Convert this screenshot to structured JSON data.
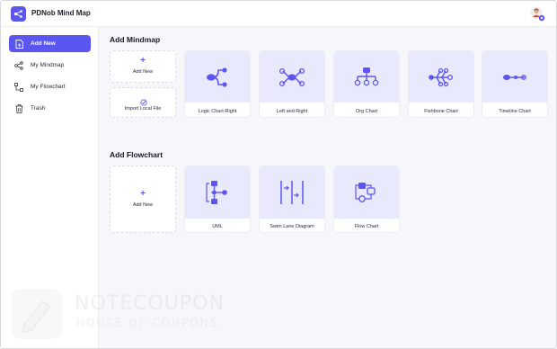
{
  "app": {
    "title": "PDNob Mind Map"
  },
  "sidebar": {
    "items": [
      {
        "label": "Add New",
        "icon": "file-plus-icon",
        "active": true
      },
      {
        "label": "My Mindmap",
        "icon": "share-nodes-icon",
        "active": false
      },
      {
        "label": "My Flowchart",
        "icon": "flowchart-icon",
        "active": false
      },
      {
        "label": "Trash",
        "icon": "trash-icon",
        "active": false
      }
    ]
  },
  "mindmap": {
    "title": "Add Mindmap",
    "add_new": "Add New",
    "import": "Import Local File",
    "templates": [
      {
        "label": "Logic Chart-Right",
        "icon": "logic-chart-icon"
      },
      {
        "label": "Left and Right",
        "icon": "left-right-icon"
      },
      {
        "label": "Org Chart",
        "icon": "org-chart-icon"
      },
      {
        "label": "Fishbone Chart",
        "icon": "fishbone-icon"
      },
      {
        "label": "Timeline Chart",
        "icon": "timeline-icon"
      }
    ]
  },
  "flowchart": {
    "title": "Add Flowchart",
    "add_new": "Add New",
    "templates": [
      {
        "label": "UML",
        "icon": "uml-icon"
      },
      {
        "label": "Swim Lane Diagram",
        "icon": "swim-lane-icon"
      },
      {
        "label": "Flow Chart",
        "icon": "flow-chart-icon"
      }
    ]
  },
  "watermark": {
    "line1": "NOTECOUPON",
    "line2": "HOUSE OF COUPONS"
  },
  "colors": {
    "accent": "#5b55f2",
    "thumb_bg": "#e9e9fd",
    "main_bg": "#f6f6fb"
  }
}
